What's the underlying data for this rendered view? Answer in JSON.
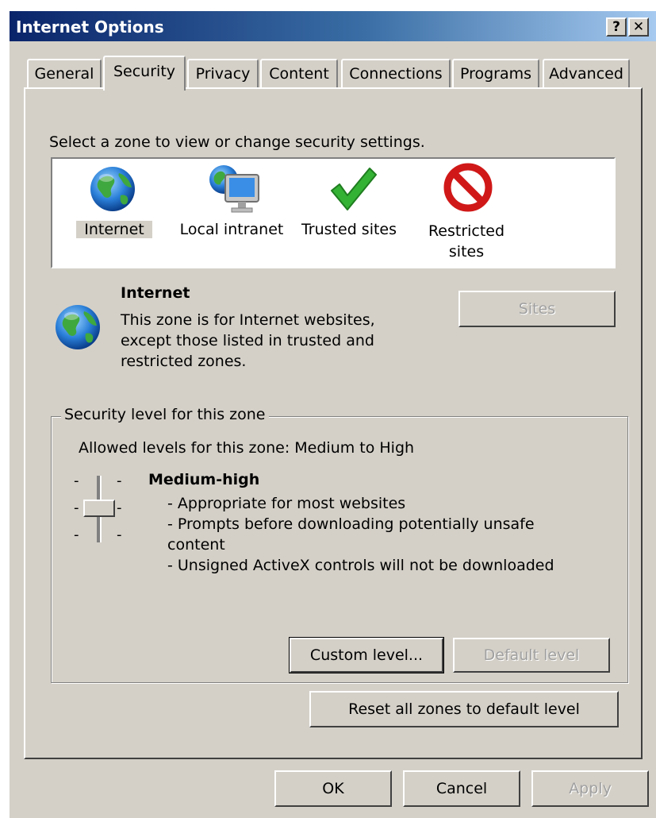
{
  "window": {
    "title": "Internet Options",
    "help_label": "?",
    "close_label": "✕"
  },
  "tabs": [
    {
      "label": "General"
    },
    {
      "label": "Security",
      "active": true
    },
    {
      "label": "Privacy"
    },
    {
      "label": "Content"
    },
    {
      "label": "Connections"
    },
    {
      "label": "Programs"
    },
    {
      "label": "Advanced"
    }
  ],
  "security": {
    "zone_prompt": "Select a zone to view or change security settings.",
    "zones": [
      {
        "label": "Internet",
        "icon": "globe-icon",
        "selected": true
      },
      {
        "label": "Local intranet",
        "icon": "intranet-icon"
      },
      {
        "label": "Trusted sites",
        "icon": "checkmark-icon"
      },
      {
        "label": "Restricted sites",
        "icon": "restricted-icon"
      }
    ],
    "selected_zone": {
      "name": "Internet",
      "icon": "globe-icon",
      "description_lines": [
        "This zone is for Internet websites,",
        "except those listed in trusted and",
        "restricted zones."
      ]
    },
    "sites_button": "Sites",
    "level_group": {
      "legend": "Security level for this zone",
      "allowed_levels": "Allowed levels for this zone: Medium to High",
      "level_name": "Medium-high",
      "level_points": [
        "- Appropriate for most websites",
        "- Prompts before downloading potentially unsafe",
        "content",
        "- Unsigned ActiveX controls will not be downloaded"
      ],
      "slider_tick": "-",
      "slider_level": "1 of 3 (middle position)",
      "custom_level_button": "Custom level...",
      "default_level_button": "Default level"
    },
    "reset_button": "Reset all zones to default level"
  },
  "footer": {
    "ok": "OK",
    "cancel": "Cancel",
    "apply": "Apply"
  },
  "colors": {
    "face": "#d4d0c8",
    "title_start": "#0a246a",
    "title_end": "#a6caf0",
    "disabled_text": "#a0a0a0"
  }
}
